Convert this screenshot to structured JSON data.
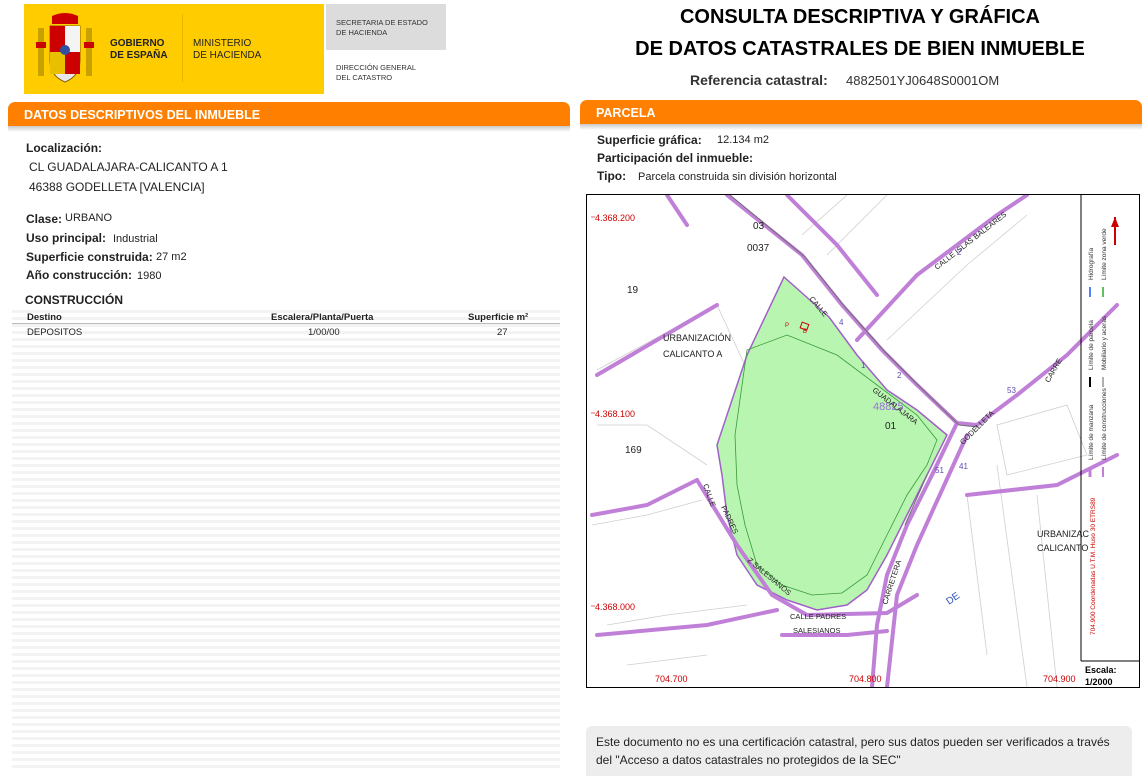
{
  "header": {
    "gov_name": "GOBIERNO\nDE ESPAÑA",
    "ministry": "MINISTERIO\nDE HACIENDA",
    "secretary": "SECRETARIA DE ESTADO\nDE HACIENDA",
    "direction": "DIRECCIÓN GENERAL\nDEL CATASTRO",
    "title_line1": "CONSULTA DESCRIPTIVA Y GRÁFICA",
    "title_line2": "DE DATOS CATASTRALES DE BIEN INMUEBLE",
    "ref_label": "Referencia catastral:",
    "ref_value": "4882501YJ0648S0001OM"
  },
  "left": {
    "section_title": "DATOS DESCRIPTIVOS DEL INMUEBLE",
    "loc_label": "Localización:",
    "loc_line1": "CL GUADALAJARA-CALICANTO A 1",
    "loc_line2": "46388 GODELLETA [VALENCIA]",
    "clase_label": "Clase:",
    "clase_value": "URBANO",
    "uso_label": "Uso principal:",
    "uso_value": "Industrial",
    "sup_label": "Superficie construida:",
    "sup_value": "27 m2",
    "anio_label": "Año construcción:",
    "anio_value": "1980",
    "construccion_title": "CONSTRUCCIÓN",
    "table": {
      "headers": [
        "Destino",
        "Escalera/Planta/Puerta",
        "Superficie m²"
      ],
      "rows": [
        [
          "DEPOSITOS",
          "1/00/00",
          "27"
        ]
      ]
    }
  },
  "right": {
    "section_title": "PARCELA",
    "sup_graf_label": "Superficie gráfica:",
    "sup_graf_value": "12.134 m2",
    "participacion_label": "Participación del inmueble:",
    "tipo_label": "Tipo:",
    "tipo_value": "Parcela construida sin división horizontal"
  },
  "map": {
    "y_coords": [
      "4.368.200",
      "4.368.100",
      "4.368.000"
    ],
    "x_coords": [
      "704.700",
      "704.800",
      "704.900"
    ],
    "parcel_numbers": [
      "03",
      "0037",
      "19",
      "169",
      "01"
    ],
    "parcel_ref": "48825",
    "area_labels": [
      "URBANIZACIÓN",
      "CALICANTO A",
      "URBANIZAC",
      "CALICANTO"
    ],
    "streets": [
      "CALLE ISLAS BALEARES",
      "CALLE",
      "GUADALAJARA",
      "GODELLETA",
      "CARRETERA",
      "CALLE PADRES",
      "SALESIANOS",
      "PADRES",
      "Z SALESIANOS",
      "CALLE",
      "CARRE",
      "DE"
    ],
    "house_numbers": [
      "2",
      "4",
      "1",
      "2",
      "53",
      "51",
      "41",
      "P",
      "B"
    ],
    "legend": [
      "Hidrografía",
      "Límite zona verde",
      "Límite de parcela",
      "Mobiliario y aceras",
      "Límite de manzana",
      "Límite de construcciones"
    ],
    "coord_note": "704.900 Coordenadas U.T.M. Huso 30 ETRS89",
    "scale_label": "Escala:",
    "scale_value": "1/2000",
    "colors": {
      "parcel_fill": "#b8f5b0",
      "boundary": "#c080d8",
      "coord_text": "#cc0000",
      "orange": "#ff8000"
    }
  },
  "note": {
    "text": "Este documento no es una certificación catastral, pero sus datos pueden ser verificados a través del \"Acceso a datos catastrales no protegidos de la SEC\""
  }
}
